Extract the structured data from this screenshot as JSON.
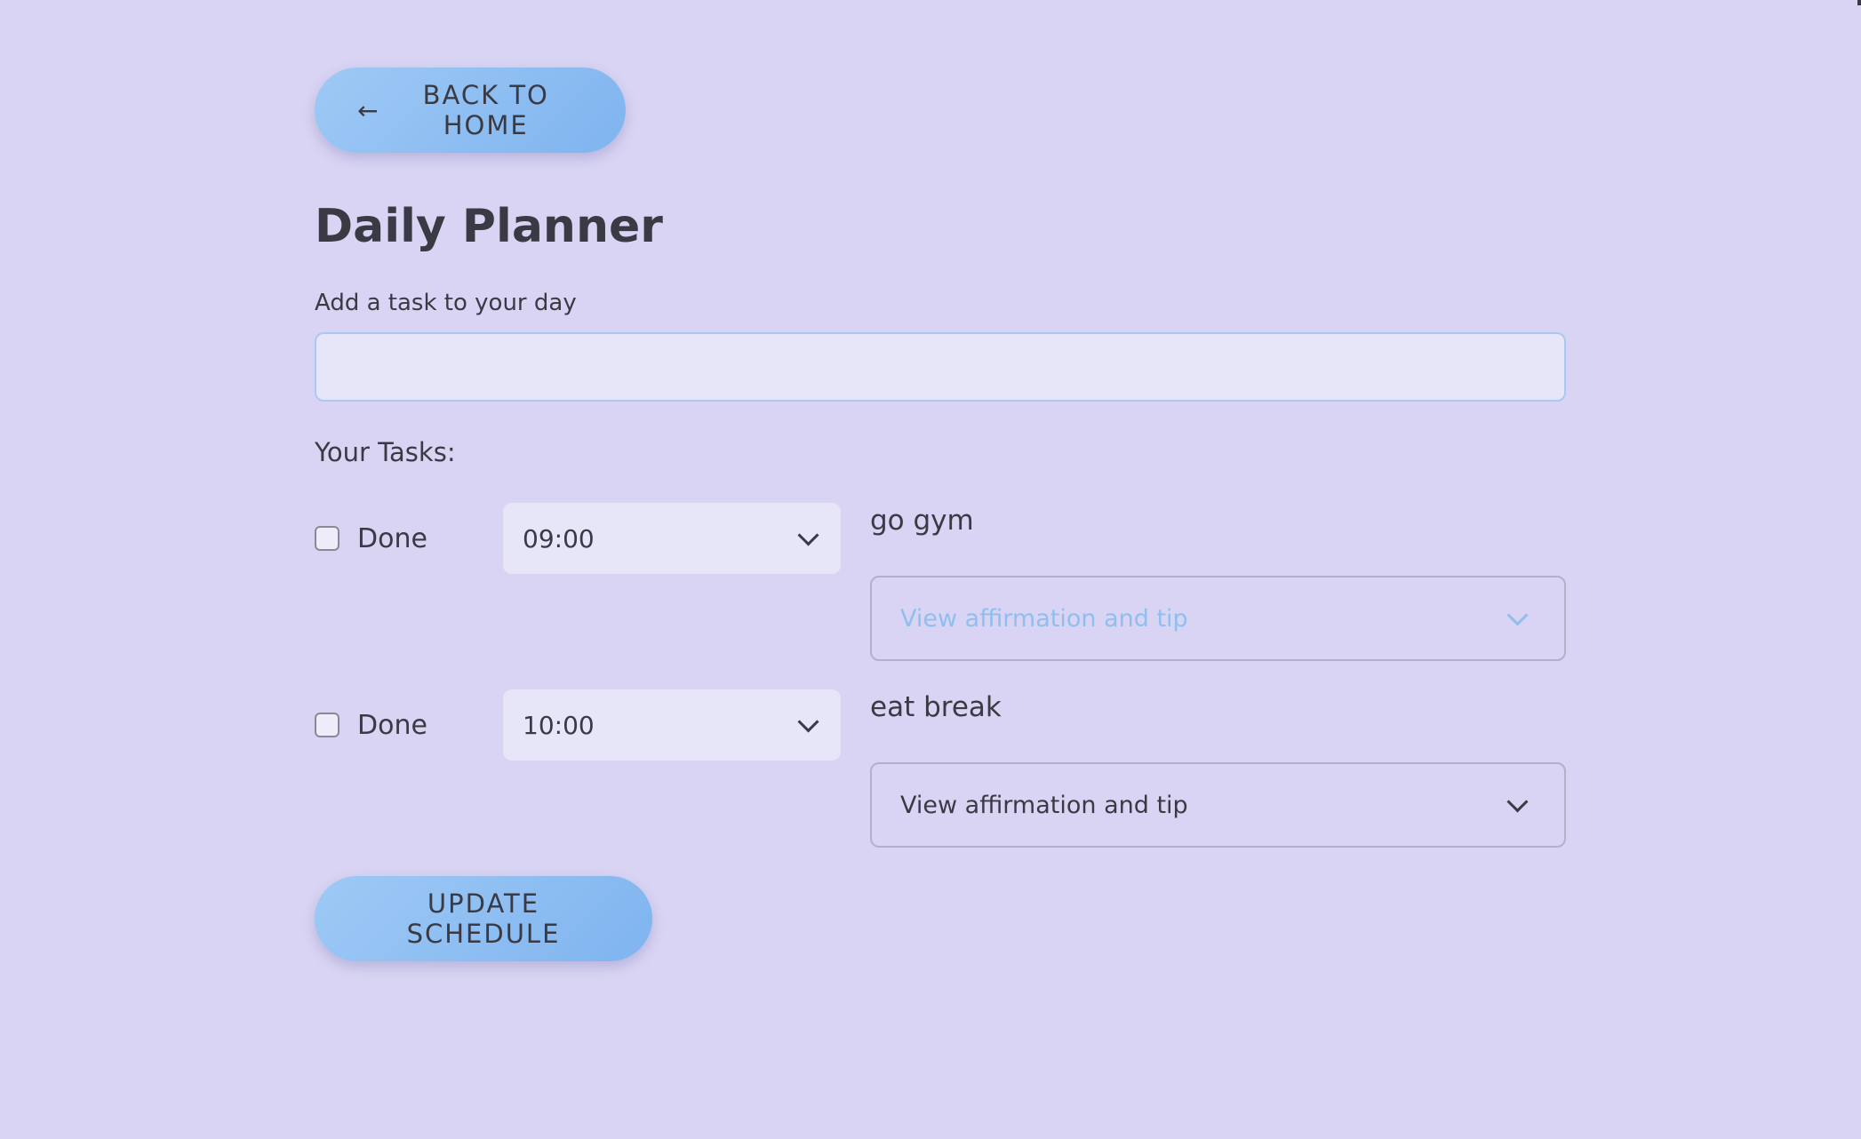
{
  "header": {
    "back_label": "BACK TO HOME",
    "back_icon": "arrow-left-icon"
  },
  "title": "Daily Planner",
  "add_task": {
    "label": "Add a task to your day",
    "value": "",
    "placeholder": ""
  },
  "tasks_heading": "Your Tasks:",
  "tasks": [
    {
      "done_label": "Done",
      "checked": false,
      "time": "09:00",
      "text": "go gym",
      "affirmation_label": "View affirmation and tip"
    },
    {
      "done_label": "Done",
      "checked": false,
      "time": "10:00",
      "text": "eat break",
      "affirmation_label": "View affirmation and tip"
    }
  ],
  "update_label": "UPDATE SCHEDULE",
  "colors": {
    "background": "#d9d4f3",
    "button_gradient_start": "#9ec9f5",
    "button_gradient_end": "#7fb4ef",
    "muted_link": "#8fbfee"
  }
}
